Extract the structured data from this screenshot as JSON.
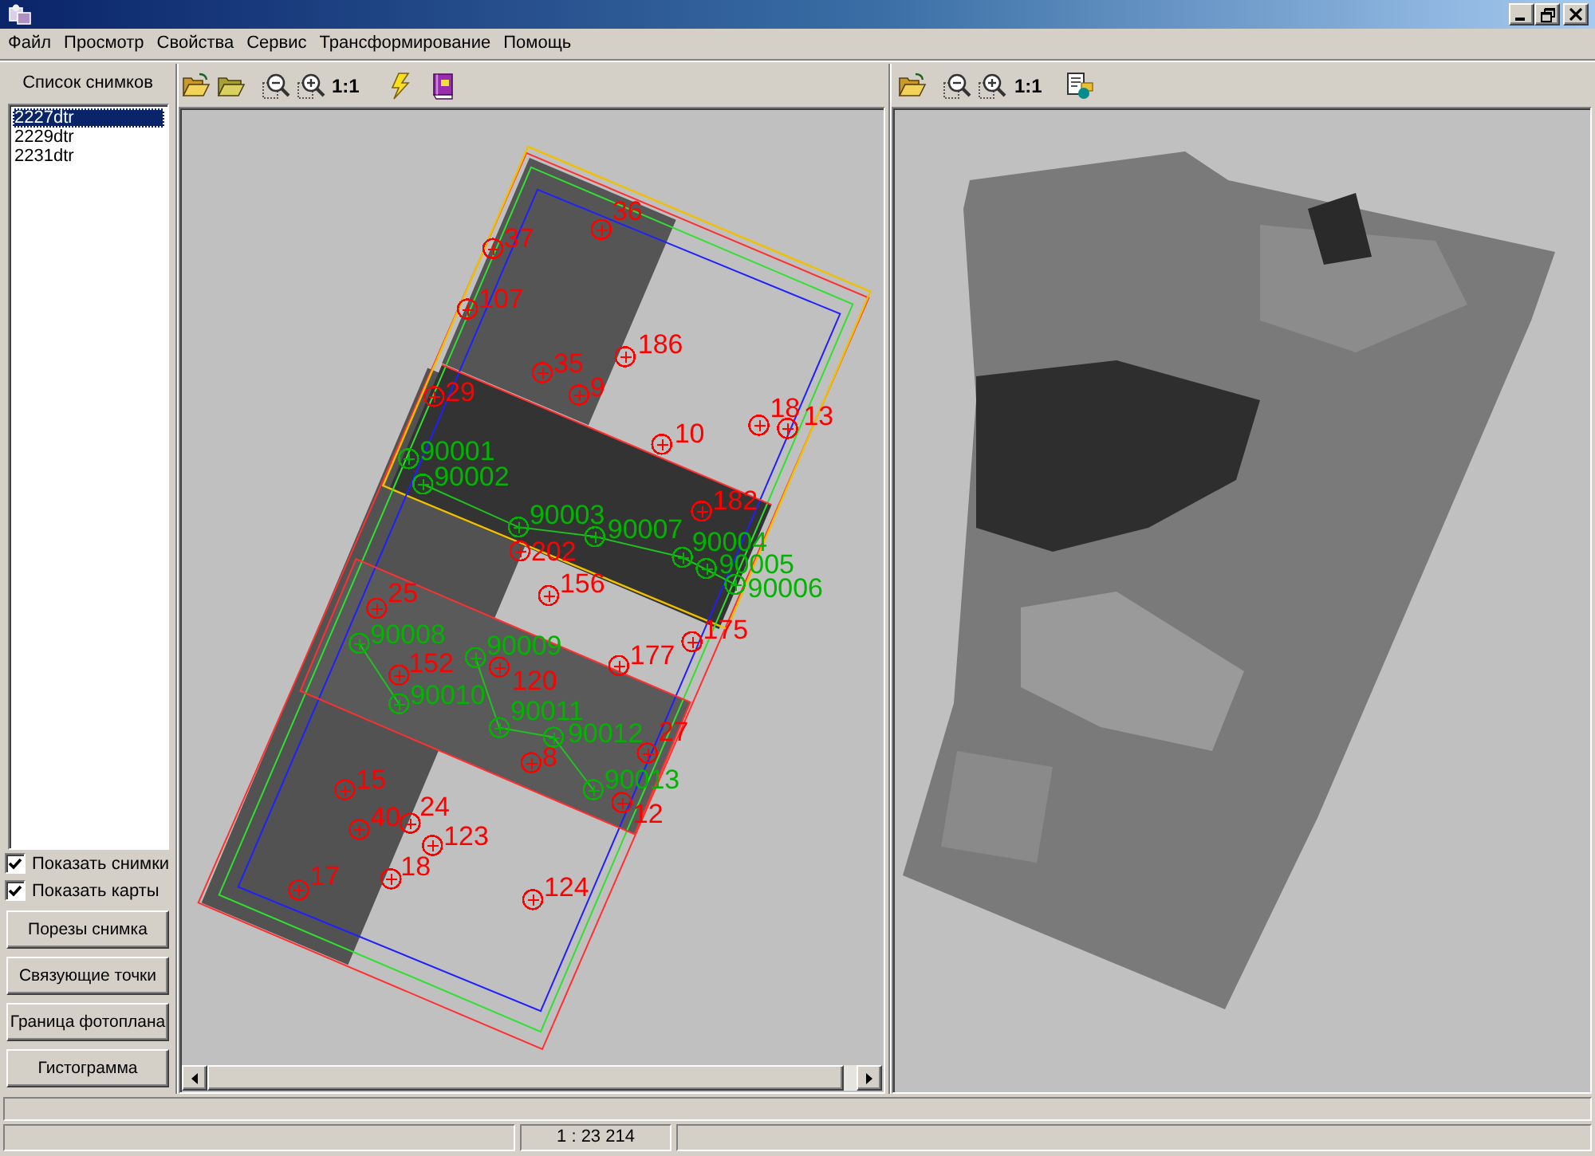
{
  "menu": [
    "Файл",
    "Просмотр",
    "Свойства",
    "Сервис",
    "Трансформирование",
    "Помощь"
  ],
  "image_list": {
    "title": "Список снимков",
    "items": [
      {
        "label": "2227dtr",
        "selected": true
      },
      {
        "label": "2229dtr",
        "selected": false
      },
      {
        "label": "2231dtr",
        "selected": false
      }
    ]
  },
  "options": [
    {
      "label": "Показать снимки",
      "checked": true
    },
    {
      "label": "Показать карты",
      "checked": true
    }
  ],
  "buttons": [
    "Порезы снимка",
    "Связующие точки",
    "Граница фотоплана",
    "Гистограмма"
  ],
  "left_view": {
    "toolbar": {
      "actual_size": "1:1"
    },
    "points": [
      {
        "label": "36",
        "color": "#ff0000"
      },
      {
        "label": "37",
        "color": "#ff0000"
      },
      {
        "label": "107",
        "color": "#ff0000"
      },
      {
        "label": "186",
        "color": "#ff0000"
      },
      {
        "label": "35",
        "color": "#ff0000"
      },
      {
        "label": "9",
        "color": "#ff0000"
      },
      {
        "label": "29",
        "color": "#ff0000"
      },
      {
        "label": "10",
        "color": "#ff0000"
      },
      {
        "label": "18",
        "color": "#ff0000"
      },
      {
        "label": "13",
        "color": "#ff0000"
      },
      {
        "label": "182",
        "color": "#ff0000"
      },
      {
        "label": "202",
        "color": "#ff0000"
      },
      {
        "label": "156",
        "color": "#ff0000"
      },
      {
        "label": "175",
        "color": "#ff0000"
      },
      {
        "label": "177",
        "color": "#ff0000"
      },
      {
        "label": "25",
        "color": "#ff0000"
      },
      {
        "label": "152",
        "color": "#ff0000"
      },
      {
        "label": "120",
        "color": "#ff0000"
      },
      {
        "label": "27",
        "color": "#ff0000"
      },
      {
        "label": "8",
        "color": "#ff0000"
      },
      {
        "label": "12",
        "color": "#ff0000"
      },
      {
        "label": "15",
        "color": "#ff0000"
      },
      {
        "label": "40",
        "color": "#ff0000"
      },
      {
        "label": "24",
        "color": "#ff0000"
      },
      {
        "label": "123",
        "color": "#ff0000"
      },
      {
        "label": "18",
        "color": "#ff0000"
      },
      {
        "label": "17",
        "color": "#ff0000"
      },
      {
        "label": "124",
        "color": "#ff0000"
      },
      {
        "label": "90001",
        "color": "#00b400"
      },
      {
        "label": "90002",
        "color": "#00b400"
      },
      {
        "label": "90003",
        "color": "#00b400"
      },
      {
        "label": "90007",
        "color": "#00b400"
      },
      {
        "label": "90004",
        "color": "#00b400"
      },
      {
        "label": "90005",
        "color": "#00b400"
      },
      {
        "label": "90006",
        "color": "#00b400"
      },
      {
        "label": "90008",
        "color": "#00b400"
      },
      {
        "label": "90009",
        "color": "#00b400"
      },
      {
        "label": "90010",
        "color": "#00b400"
      },
      {
        "label": "90011",
        "color": "#00b400"
      },
      {
        "label": "90012",
        "color": "#00b400"
      },
      {
        "label": "90013",
        "color": "#00b400"
      }
    ]
  },
  "right_view": {
    "toolbar": {
      "actual_size": "1:1"
    }
  },
  "status_bar": {
    "scale": "1 : 23 214"
  }
}
